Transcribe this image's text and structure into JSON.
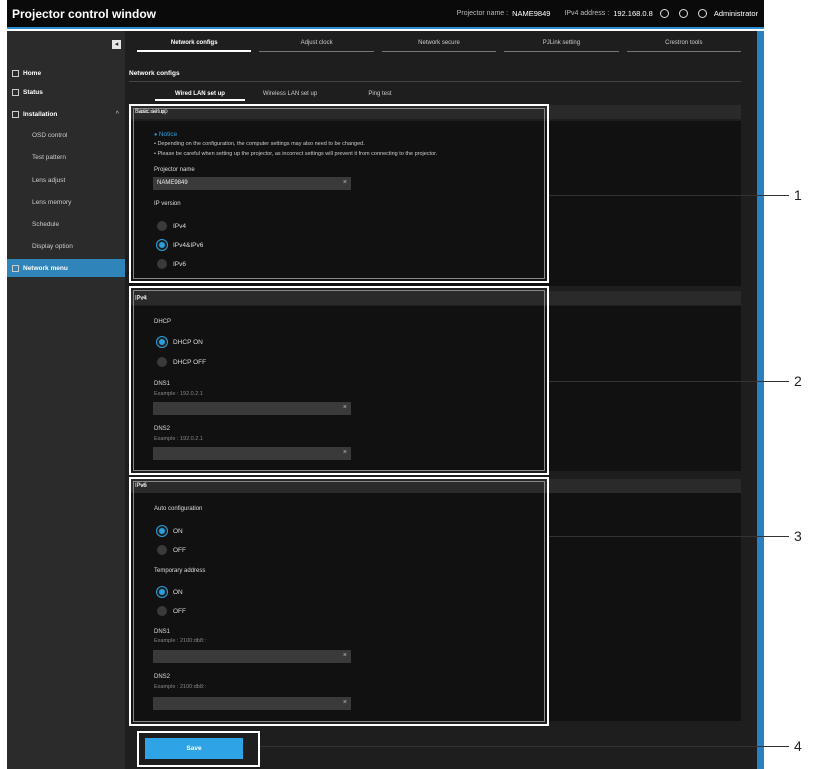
{
  "app_title": "Projector control window",
  "top": {
    "name_label": "Projector name :",
    "name_value": "NAME9849",
    "ip_label": "IPv4 address :",
    "ip_value": "192.168.0.8",
    "user": "Administrator",
    "icons": [
      "gear-icon",
      "info-icon",
      "user-icon"
    ]
  },
  "sidebar": {
    "collapse": "◂",
    "items": [
      {
        "label": "Home",
        "icon": "home-icon"
      },
      {
        "label": "Status",
        "icon": "status-icon"
      },
      {
        "label": "Installation",
        "icon": "settings-icon"
      },
      {
        "label": "OSD control"
      },
      {
        "label": "Test pattern"
      },
      {
        "label": "Lens adjust"
      },
      {
        "label": "Lens memory"
      },
      {
        "label": "Schedule"
      },
      {
        "label": "Display option"
      },
      {
        "label": "Network menu",
        "icon": "globe-icon"
      }
    ]
  },
  "tabs": [
    "Network configs",
    "Adjust clock",
    "Network secure",
    "PJLink setting",
    "Crestron tools"
  ],
  "section_title": "Network configs",
  "subtabs": [
    "Wired LAN set up",
    "Wireless LAN set up",
    "Ping test"
  ],
  "basic": {
    "head": "Basic set up",
    "notice_title": "Notice",
    "notice_1": "•  Depending on the configuration, the computer settings may also need to be changed.",
    "notice_2": "•  Please be careful when setting up the projector, as incorrect settings will prevent it from connecting to the projector.",
    "proj_name_label": "Projector name",
    "proj_name_value": "NAME9849",
    "ip_version_label": "IP version",
    "ip_options": [
      "IPv4",
      "IPv4&IPv6",
      "IPv6"
    ],
    "ip_selected": "IPv4&IPv6"
  },
  "ipv4": {
    "head": "IPv4",
    "dhcp_label": "DHCP",
    "dhcp_on": "DHCP ON",
    "dhcp_off": "DHCP OFF",
    "dns1_label": "DNS1",
    "dns1_hint": "Example : 192.0.2.1",
    "dns2_label": "DNS2",
    "dns2_hint": "Example : 192.0.2.1"
  },
  "ipv6": {
    "head": "IPv6",
    "auto_label": "Auto configuration",
    "on": "ON",
    "off": "OFF",
    "temp_label": "Temporary address",
    "dns1_label": "DNS1",
    "dns1_hint": "Example : 2100:db8::",
    "dns2_label": "DNS2",
    "dns2_hint": "Example : 2100:db8::"
  },
  "save_label": "Save",
  "callouts": [
    "1",
    "2",
    "3",
    "4"
  ],
  "colors": {
    "accent": "#2a9fe0",
    "background": "#1e1e1e",
    "sidebar": "#2b2b2b"
  }
}
